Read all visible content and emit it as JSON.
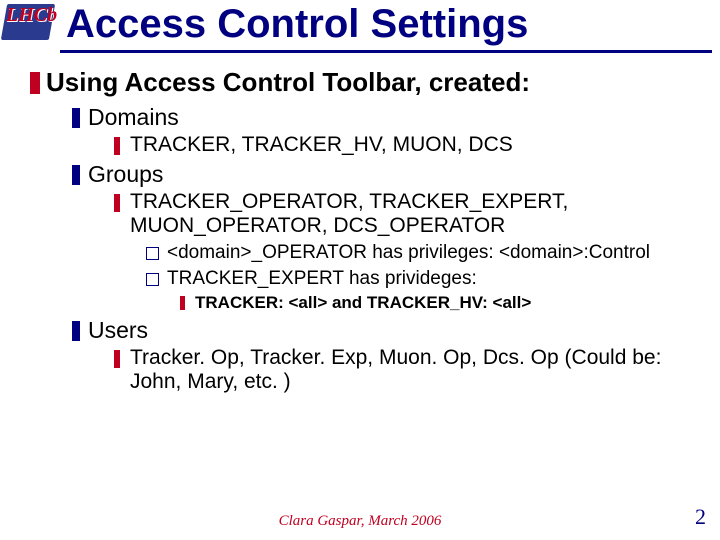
{
  "logo_text": "LHCb",
  "title": "Access Control Settings",
  "lvl1": "Using Access Control Toolbar, created:",
  "domains": {
    "label": "Domains",
    "items": "TRACKER, TRACKER_HV, MUON, DCS"
  },
  "groups": {
    "label": "Groups",
    "items": "TRACKER_OPERATOR, TRACKER_EXPERT, MUON_OPERATOR, DCS_OPERATOR",
    "note1": "<domain>_OPERATOR has privileges: <domain>:Control",
    "note2": "TRACKER_EXPERT has privideges:",
    "note3": "TRACKER: <all> and TRACKER_HV: <all>"
  },
  "users": {
    "label": "Users",
    "items": "Tracker. Op, Tracker. Exp, Muon. Op, Dcs. Op (Could be: John, Mary, etc. )"
  },
  "footer": {
    "author": "Clara Gaspar, March 2006",
    "page": "2"
  }
}
